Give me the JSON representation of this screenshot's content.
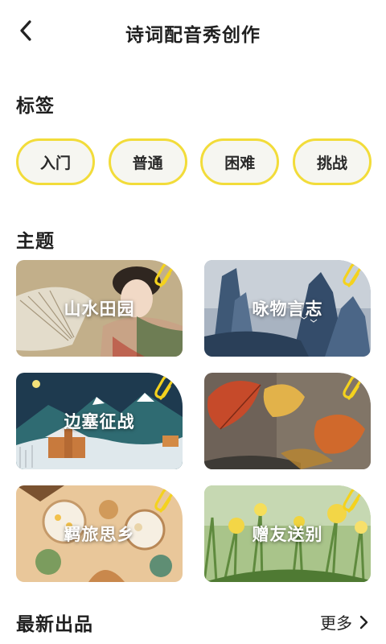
{
  "header": {
    "title": "诗词配音秀创作",
    "back_icon": "chevron-left-icon"
  },
  "tags_section": {
    "title": "标签",
    "tags": [
      {
        "label": "入门"
      },
      {
        "label": "普通"
      },
      {
        "label": "困难"
      },
      {
        "label": "挑战"
      }
    ],
    "border_color": "#f2dc3a"
  },
  "themes_section": {
    "title": "主题",
    "cards": [
      {
        "label": "山水田园",
        "icon": "paperclip-icon"
      },
      {
        "label": "咏物言志",
        "icon": "paperclip-icon"
      },
      {
        "label": "边塞征战",
        "icon": "paperclip-icon"
      },
      {
        "label": "羁旅思乡",
        "icon": "paperclip-icon"
      },
      {
        "label": "赠友送别",
        "icon": "paperclip-icon"
      }
    ],
    "clip_color": "#f4d21e"
  },
  "latest_section": {
    "title": "最新出品",
    "more_label": "更多",
    "more_icon": "chevron-right-icon"
  }
}
